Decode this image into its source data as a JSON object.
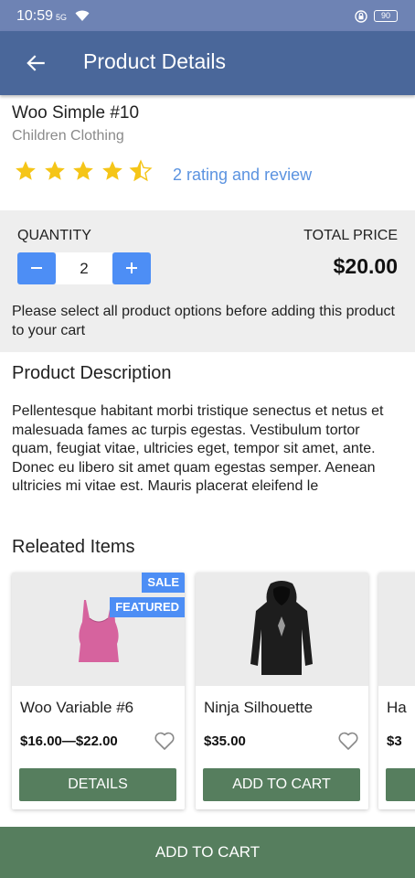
{
  "status_bar": {
    "time": "10:59",
    "signal": "5G",
    "battery": "90"
  },
  "app_bar": {
    "title": "Product Details"
  },
  "product": {
    "name": "Woo Simple #10",
    "category": "Children Clothing",
    "rating": 4.5,
    "rating_link": "2 rating and review"
  },
  "quantity_section": {
    "quantity_label": "QUANTITY",
    "quantity_value": "2",
    "total_label": "TOTAL PRICE",
    "total_value": "$20.00",
    "notice": "Please select all product options before adding this product to your cart"
  },
  "description": {
    "heading": "Product Description",
    "body": "Pellentesque habitant morbi tristique senectus et netus et malesuada fames ac turpis egestas. Vestibulum tortor quam, feugiat vitae, ultricies eget, tempor sit amet, ante. Donec eu libero sit amet quam egestas semper. Aenean ultricies mi vitae est. Mauris placerat eleifend le"
  },
  "related": {
    "heading": "Releated Items",
    "items": [
      {
        "name": "Woo Variable #6",
        "price": "$16.00—$22.00",
        "button": "DETAILS",
        "badges": [
          "SALE",
          "FEATURED"
        ]
      },
      {
        "name": "Ninja Silhouette",
        "price": "$35.00",
        "button": "ADD TO CART",
        "badges": []
      },
      {
        "name": "Ha",
        "price": "$3"
      }
    ]
  },
  "bottom_button": {
    "label": "ADD TO CART"
  },
  "colors": {
    "app_bar": "#4a679a",
    "status_bar": "#6e83b4",
    "accent_blue": "#4d8ef5",
    "button_green": "#567e5e",
    "star_yellow": "#f5c518",
    "link_blue": "#5b93e0"
  },
  "icons": {
    "back": "arrow-left-icon",
    "star": "star-icon",
    "heart": "heart-outline-icon",
    "minus": "minus-icon",
    "plus": "plus-icon"
  }
}
